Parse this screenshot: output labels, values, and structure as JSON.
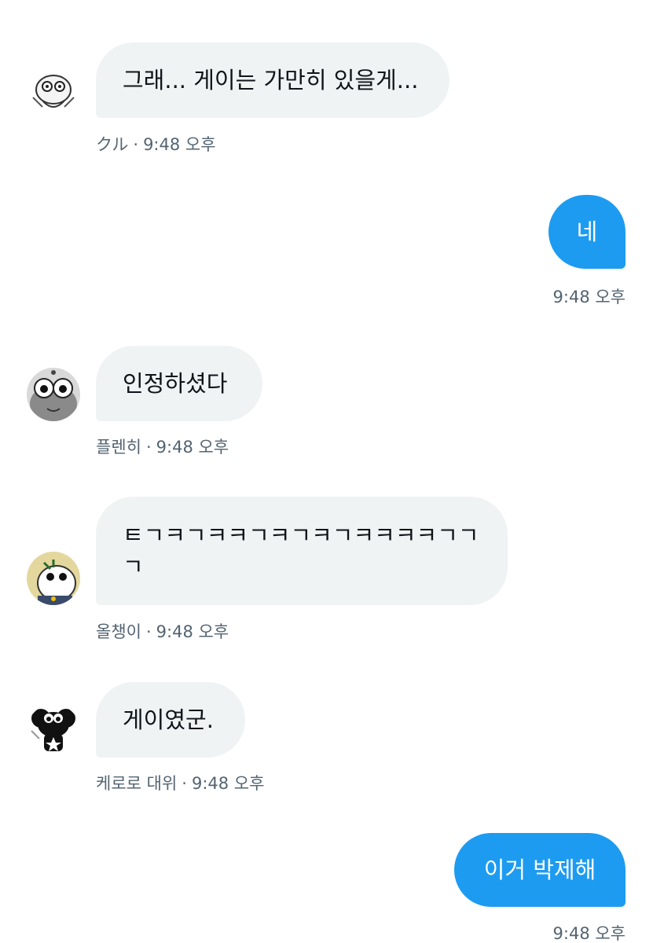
{
  "conversation": {
    "messages": [
      {
        "direction": "incoming",
        "text": "그래... 게이는 가만히 있을게...",
        "sender": "クル",
        "time": "9:48 오후",
        "avatar_icon": "keroro-kururu-sketch-avatar"
      },
      {
        "direction": "outgoing",
        "text": "네",
        "time": "9:48 오후"
      },
      {
        "direction": "incoming",
        "text": "인정하셨다",
        "sender": "플렌히",
        "time": "9:48 오후",
        "avatar_icon": "gray-frog-avatar"
      },
      {
        "direction": "incoming",
        "text": "ㅌㄱㅋㄱㅋㅋㄱㅋㄱㅋㄱㅋㅋㅋㅋㄱㄱㄱ",
        "sender": "올챙이",
        "time": "9:48 오후",
        "avatar_icon": "white-frog-avatar"
      },
      {
        "direction": "incoming",
        "text": "게이였군.",
        "sender": "케로로 대위",
        "time": "9:48 오후",
        "avatar_icon": "black-keroro-avatar"
      },
      {
        "direction": "outgoing",
        "text": "이거 박제해",
        "time": "9:48 오후"
      }
    ]
  },
  "colors": {
    "incoming_bubble": "#eff3f4",
    "outgoing_bubble": "#1d9bf0",
    "meta_text": "#536471",
    "text": "#0f1419"
  }
}
